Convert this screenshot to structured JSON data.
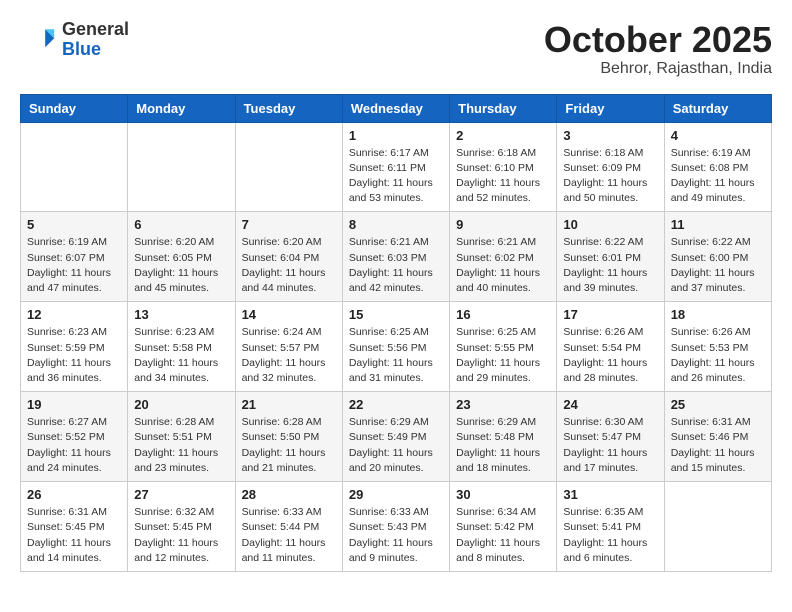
{
  "header": {
    "logo_general": "General",
    "logo_blue": "Blue",
    "month_title": "October 2025",
    "location": "Behror, Rajasthan, India"
  },
  "days_of_week": [
    "Sunday",
    "Monday",
    "Tuesday",
    "Wednesday",
    "Thursday",
    "Friday",
    "Saturday"
  ],
  "weeks": [
    [
      {
        "day": "",
        "info": ""
      },
      {
        "day": "",
        "info": ""
      },
      {
        "day": "",
        "info": ""
      },
      {
        "day": "1",
        "info": "Sunrise: 6:17 AM\nSunset: 6:11 PM\nDaylight: 11 hours\nand 53 minutes."
      },
      {
        "day": "2",
        "info": "Sunrise: 6:18 AM\nSunset: 6:10 PM\nDaylight: 11 hours\nand 52 minutes."
      },
      {
        "day": "3",
        "info": "Sunrise: 6:18 AM\nSunset: 6:09 PM\nDaylight: 11 hours\nand 50 minutes."
      },
      {
        "day": "4",
        "info": "Sunrise: 6:19 AM\nSunset: 6:08 PM\nDaylight: 11 hours\nand 49 minutes."
      }
    ],
    [
      {
        "day": "5",
        "info": "Sunrise: 6:19 AM\nSunset: 6:07 PM\nDaylight: 11 hours\nand 47 minutes."
      },
      {
        "day": "6",
        "info": "Sunrise: 6:20 AM\nSunset: 6:05 PM\nDaylight: 11 hours\nand 45 minutes."
      },
      {
        "day": "7",
        "info": "Sunrise: 6:20 AM\nSunset: 6:04 PM\nDaylight: 11 hours\nand 44 minutes."
      },
      {
        "day": "8",
        "info": "Sunrise: 6:21 AM\nSunset: 6:03 PM\nDaylight: 11 hours\nand 42 minutes."
      },
      {
        "day": "9",
        "info": "Sunrise: 6:21 AM\nSunset: 6:02 PM\nDaylight: 11 hours\nand 40 minutes."
      },
      {
        "day": "10",
        "info": "Sunrise: 6:22 AM\nSunset: 6:01 PM\nDaylight: 11 hours\nand 39 minutes."
      },
      {
        "day": "11",
        "info": "Sunrise: 6:22 AM\nSunset: 6:00 PM\nDaylight: 11 hours\nand 37 minutes."
      }
    ],
    [
      {
        "day": "12",
        "info": "Sunrise: 6:23 AM\nSunset: 5:59 PM\nDaylight: 11 hours\nand 36 minutes."
      },
      {
        "day": "13",
        "info": "Sunrise: 6:23 AM\nSunset: 5:58 PM\nDaylight: 11 hours\nand 34 minutes."
      },
      {
        "day": "14",
        "info": "Sunrise: 6:24 AM\nSunset: 5:57 PM\nDaylight: 11 hours\nand 32 minutes."
      },
      {
        "day": "15",
        "info": "Sunrise: 6:25 AM\nSunset: 5:56 PM\nDaylight: 11 hours\nand 31 minutes."
      },
      {
        "day": "16",
        "info": "Sunrise: 6:25 AM\nSunset: 5:55 PM\nDaylight: 11 hours\nand 29 minutes."
      },
      {
        "day": "17",
        "info": "Sunrise: 6:26 AM\nSunset: 5:54 PM\nDaylight: 11 hours\nand 28 minutes."
      },
      {
        "day": "18",
        "info": "Sunrise: 6:26 AM\nSunset: 5:53 PM\nDaylight: 11 hours\nand 26 minutes."
      }
    ],
    [
      {
        "day": "19",
        "info": "Sunrise: 6:27 AM\nSunset: 5:52 PM\nDaylight: 11 hours\nand 24 minutes."
      },
      {
        "day": "20",
        "info": "Sunrise: 6:28 AM\nSunset: 5:51 PM\nDaylight: 11 hours\nand 23 minutes."
      },
      {
        "day": "21",
        "info": "Sunrise: 6:28 AM\nSunset: 5:50 PM\nDaylight: 11 hours\nand 21 minutes."
      },
      {
        "day": "22",
        "info": "Sunrise: 6:29 AM\nSunset: 5:49 PM\nDaylight: 11 hours\nand 20 minutes."
      },
      {
        "day": "23",
        "info": "Sunrise: 6:29 AM\nSunset: 5:48 PM\nDaylight: 11 hours\nand 18 minutes."
      },
      {
        "day": "24",
        "info": "Sunrise: 6:30 AM\nSunset: 5:47 PM\nDaylight: 11 hours\nand 17 minutes."
      },
      {
        "day": "25",
        "info": "Sunrise: 6:31 AM\nSunset: 5:46 PM\nDaylight: 11 hours\nand 15 minutes."
      }
    ],
    [
      {
        "day": "26",
        "info": "Sunrise: 6:31 AM\nSunset: 5:45 PM\nDaylight: 11 hours\nand 14 minutes."
      },
      {
        "day": "27",
        "info": "Sunrise: 6:32 AM\nSunset: 5:45 PM\nDaylight: 11 hours\nand 12 minutes."
      },
      {
        "day": "28",
        "info": "Sunrise: 6:33 AM\nSunset: 5:44 PM\nDaylight: 11 hours\nand 11 minutes."
      },
      {
        "day": "29",
        "info": "Sunrise: 6:33 AM\nSunset: 5:43 PM\nDaylight: 11 hours\nand 9 minutes."
      },
      {
        "day": "30",
        "info": "Sunrise: 6:34 AM\nSunset: 5:42 PM\nDaylight: 11 hours\nand 8 minutes."
      },
      {
        "day": "31",
        "info": "Sunrise: 6:35 AM\nSunset: 5:41 PM\nDaylight: 11 hours\nand 6 minutes."
      },
      {
        "day": "",
        "info": ""
      }
    ]
  ]
}
